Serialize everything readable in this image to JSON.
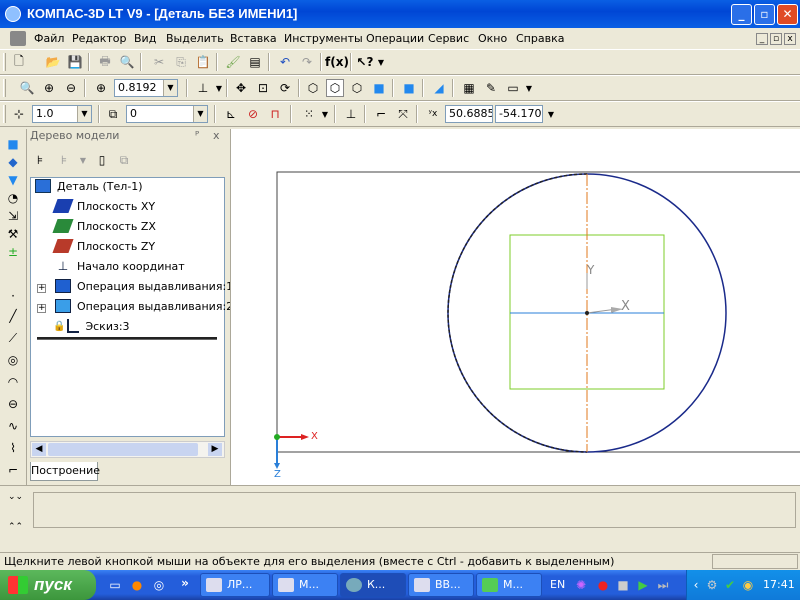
{
  "window": {
    "title": "КОМПАС-3D LT V9 - [Деталь БЕЗ ИМЕНИ1]",
    "minimize": "_",
    "maximize": "▫",
    "close": "✕"
  },
  "menu": [
    {
      "label": "Файл"
    },
    {
      "label": "Редактор"
    },
    {
      "label": "Вид"
    },
    {
      "label": "Выделить"
    },
    {
      "label": "Вставка"
    },
    {
      "label": "Инструменты"
    },
    {
      "label": "Операции"
    },
    {
      "label": "Сервис"
    },
    {
      "label": "Окно"
    },
    {
      "label": "Справка"
    }
  ],
  "toolbar_view": {
    "zoom_value": "0.8192"
  },
  "toolbar_props": {
    "step_value": "1.0",
    "layer_value": "0",
    "coord_x": "50.6885",
    "coord_y": "-54.170"
  },
  "tree_panel": {
    "header": "Дерево модели",
    "pin": "ᴾ",
    "close": "x",
    "items": [
      {
        "label": "Деталь (Тел-1)"
      },
      {
        "label": "Плоскость XY"
      },
      {
        "label": "Плоскость ZX"
      },
      {
        "label": "Плоскость ZY"
      },
      {
        "label": "Начало координат"
      },
      {
        "label": "Операция выдавливания:1"
      },
      {
        "label": "Операция выдавливания:2"
      },
      {
        "label": "Эскиз:3"
      }
    ],
    "tab": "Построение"
  },
  "canvas": {
    "axis_x": "X",
    "axis_z": "Z",
    "label_y": "Y",
    "label_x": "X"
  },
  "status": {
    "message": "Щелкните левой кнопкой мыши на объекте для его выделения (вместе с Ctrl - добавить к выделенным)"
  },
  "taskbar": {
    "start": "пуск",
    "buttons": [
      {
        "label": "ЛР..."
      },
      {
        "label": "М..."
      },
      {
        "label": "К..."
      },
      {
        "label": "ВВ..."
      },
      {
        "label": "М..."
      }
    ],
    "lang": "EN",
    "clock": "17:41"
  },
  "colors": {
    "title_blue": "#0a5fe4",
    "sketch_green": "#7ccc2a",
    "axis_orange": "#e07a1c",
    "circle_navy": "#1a2a8a"
  }
}
